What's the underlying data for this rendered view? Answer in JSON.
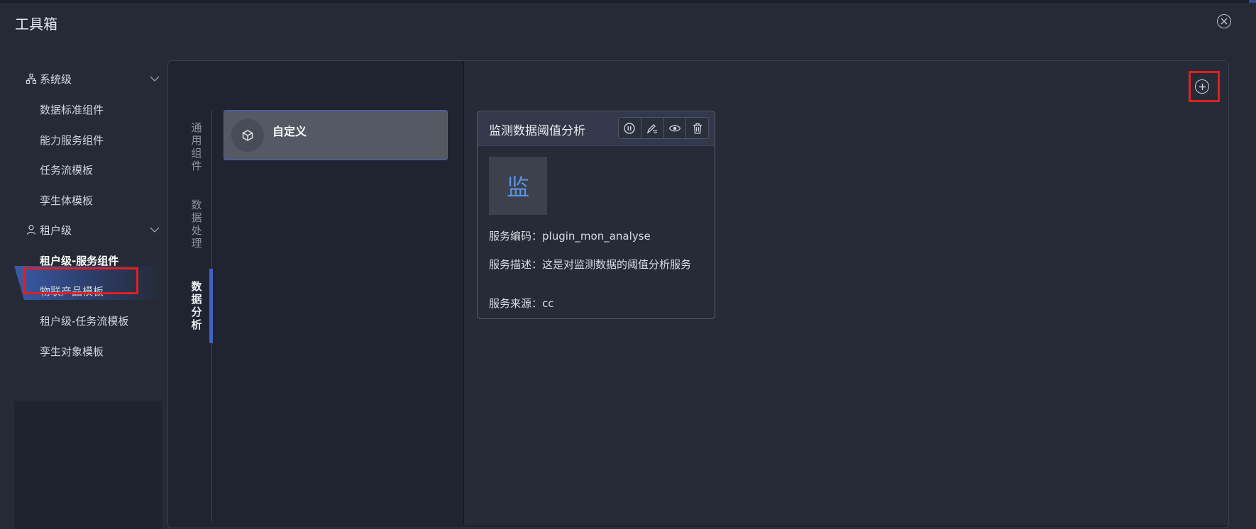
{
  "dialog": {
    "title": "工具箱"
  },
  "sidebar": {
    "groups": [
      {
        "label": "系统级",
        "items": [
          "数据标准组件",
          "能力服务组件",
          "任务流模板",
          "孪生体模板"
        ]
      },
      {
        "label": "租户级",
        "items": [
          "租户级-服务组件",
          "物联产品模板",
          "租户级-任务流模板",
          "孪生对象模板"
        ]
      }
    ],
    "active_item": "租户级-服务组件"
  },
  "vertical_tabs": [
    {
      "label": "通用组件",
      "chars": [
        "通",
        "用",
        "组",
        "件"
      ]
    },
    {
      "label": "数据处理",
      "chars": [
        "数",
        "据",
        "处",
        "理"
      ]
    },
    {
      "label": "数据分析",
      "chars": [
        "数",
        "据",
        "分",
        "析"
      ]
    }
  ],
  "active_tab": "数据分析",
  "category_list": [
    {
      "label": "自定义",
      "icon": "cube-icon"
    }
  ],
  "cards": [
    {
      "title": "监测数据阈值分析",
      "avatar_char": "监",
      "code_label": "服务编码：",
      "code_value": "plugin_mon_analyse",
      "desc_label": "服务描述：",
      "desc_value": "这是对监测数据的阈值分析服务",
      "source_label": "服务来源：",
      "source_value": "cc",
      "actions": [
        "pause-icon",
        "edit-icon",
        "view-icon",
        "delete-icon"
      ]
    }
  ],
  "colors": {
    "accent": "#3f63c6",
    "highlight_box": "#e02020",
    "avatar_text": "#5a92e6"
  }
}
